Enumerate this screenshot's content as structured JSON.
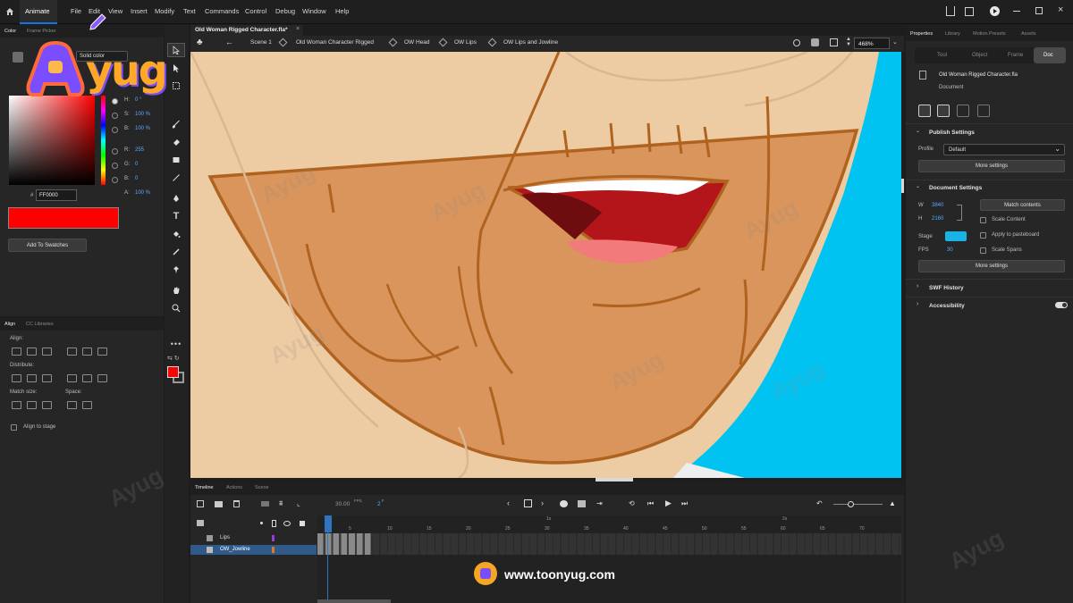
{
  "menubar": {
    "app_tab": "Animate",
    "items": [
      "File",
      "Edit",
      "View",
      "Insert",
      "Modify",
      "Text",
      "Commands",
      "Control",
      "Debug",
      "Window",
      "Help"
    ]
  },
  "color_panel": {
    "tabs": [
      "Color",
      "Frame Picker"
    ],
    "mode": "Solid color",
    "h_label": "H:",
    "h_value": "0 °",
    "s_label": "S:",
    "s_value": "100 %",
    "b_label": "B:",
    "b_value": "100 %",
    "r_label": "R:",
    "r_value": "255",
    "g_label": "G:",
    "g_value": "0",
    "bl_label": "B:",
    "bl_value": "0",
    "a_label": "A:",
    "a_value": "100 %",
    "hex_prefix": "#",
    "hex_value": "FF0000",
    "swatch_color": "#FF0000",
    "add_swatch": "Add To Swatches"
  },
  "align_panel": {
    "tabs": [
      "Align",
      "CC Libraries"
    ],
    "align_label": "Align:",
    "distribute_label": "Distribute:",
    "match_label": "Match size:",
    "space_label": "Space:",
    "align_to_stage": "Align to stage"
  },
  "document": {
    "tab_title": "Old Woman Rigged Character.fla*",
    "breadcrumb": [
      "Scene 1",
      "Old Woman Character Rigged",
      "OW Head",
      "OW Lips",
      "OW Lips and Jowline"
    ],
    "zoom": "468%"
  },
  "properties": {
    "tabs": [
      "Properties",
      "Library",
      "Motion Presets",
      "Assets"
    ],
    "subtabs": [
      "Tool",
      "Object",
      "Frame",
      "Doc"
    ],
    "file_name": "Old Woman Rigged Character.fla",
    "file_type": "Document",
    "publish_settings": "Publish Settings",
    "profile_label": "Profile",
    "profile_value": "Default",
    "more_settings": "More settings",
    "document_settings": "Document Settings",
    "w_label": "W",
    "w_value": "3840",
    "h_label": "H",
    "h_value": "2160",
    "match_contents": "Match contents",
    "scale_content": "Scale Content",
    "stage_label": "Stage",
    "stage_color": "#19b4e6",
    "apply_pasteboard": "Apply to pasteboard",
    "fps_label": "FPS",
    "fps_value": "30",
    "scale_spans": "Scale Spans",
    "more_settings_2": "More settings",
    "swf_history": "SWF History",
    "accessibility": "Accessibility"
  },
  "timeline": {
    "tabs": [
      "Timeline",
      "Actions",
      "Scene"
    ],
    "fps": "30.00",
    "fps_unit": "FPS",
    "frame": "2",
    "frame_unit": "F",
    "sec_markers": [
      "1s",
      "2s"
    ],
    "frame_ticks": [
      "5",
      "10",
      "15",
      "20",
      "25",
      "30",
      "35",
      "40",
      "45",
      "50",
      "55",
      "60",
      "65",
      "70"
    ],
    "layers": [
      {
        "name": "Lips",
        "color": "#9b3bd8"
      },
      {
        "name": "OW_Jowline",
        "color": "#e07a2b"
      }
    ]
  },
  "watermark": {
    "logo_text": "yug",
    "url": "www.toonyug.com"
  },
  "icons": [
    "home-icon",
    "brush-icon",
    "selection-icon",
    "subselection-icon",
    "free-transform-icon",
    "pencil-icon",
    "eraser-icon",
    "rectangle-icon",
    "line-icon",
    "pen-icon",
    "text-icon",
    "paint-bucket-icon",
    "eyedropper-icon",
    "pin-icon",
    "hand-icon",
    "zoom-icon",
    "more-icon",
    "stroke-color-icon",
    "fill-color-icon",
    "share-icon",
    "play-icon",
    "search-icon"
  ]
}
